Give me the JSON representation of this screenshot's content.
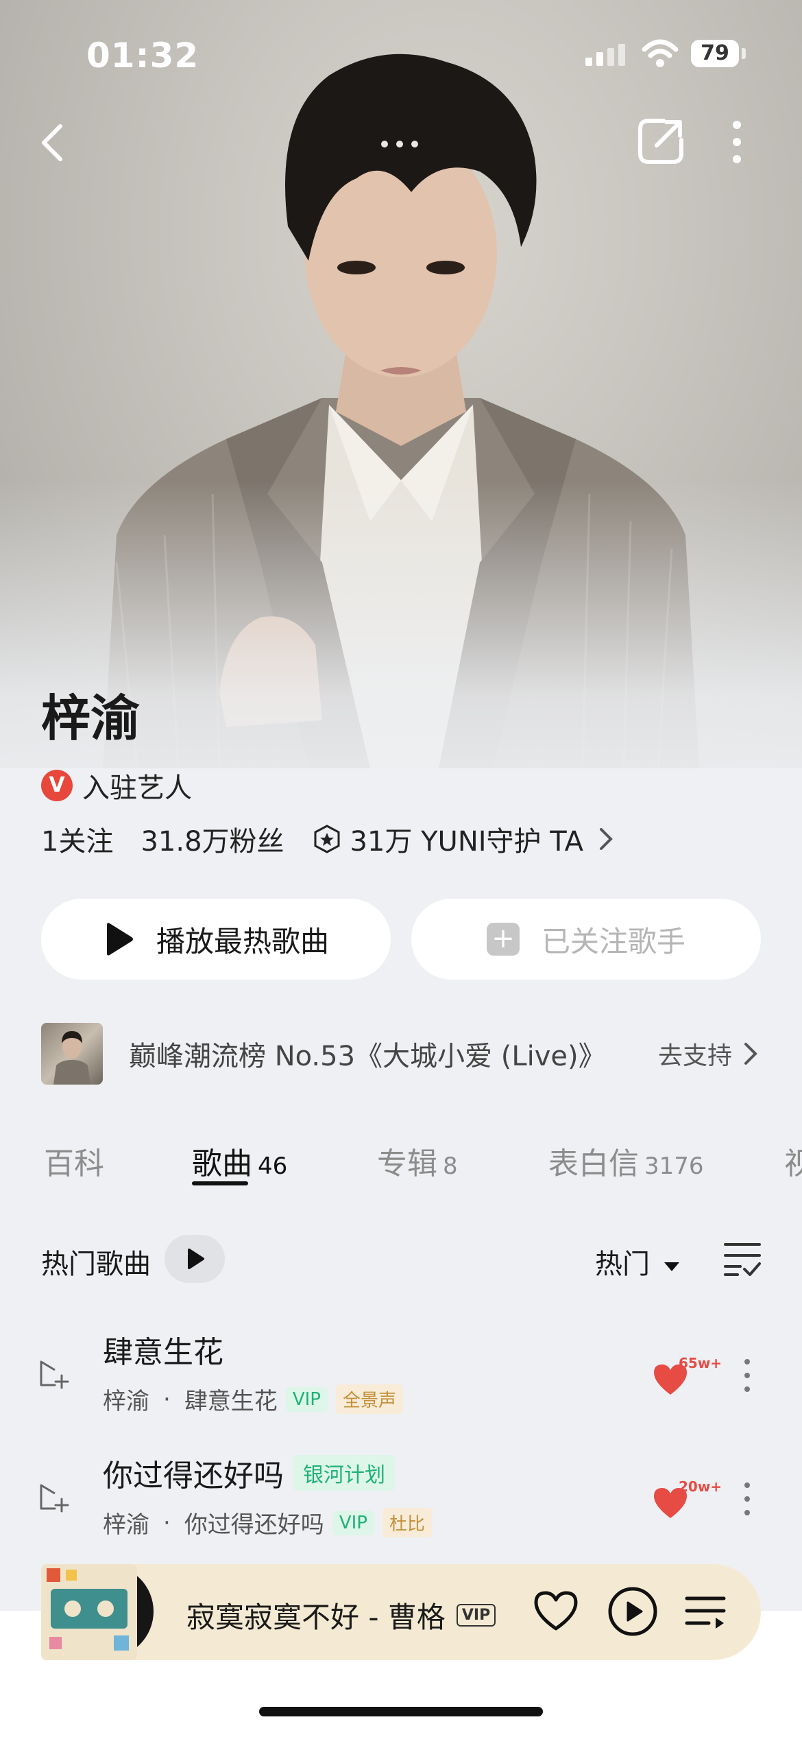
{
  "status": {
    "time": "01:32",
    "battery": "79"
  },
  "artist": {
    "name": "梓渝",
    "verified_label": "入驻艺人",
    "verified_badge": "V",
    "following": "1关注",
    "fans": "31.8万粉丝",
    "guard": "31万 YUNI守护 TA"
  },
  "buttons": {
    "play_hot": "播放最热歌曲",
    "followed": "已关注歌手"
  },
  "rank": {
    "text": "巅峰潮流榜 No.53《大城小爱 (Live)》",
    "action": "去支持"
  },
  "tabs": [
    {
      "label": "百科",
      "count": ""
    },
    {
      "label": "歌曲",
      "count": "46"
    },
    {
      "label": "专辑",
      "count": "8"
    },
    {
      "label": "表白信",
      "count": "3176"
    },
    {
      "label": "视",
      "count": ""
    }
  ],
  "hot": {
    "title": "热门歌曲",
    "sort": "热门"
  },
  "songs": [
    {
      "title": "肆意生花",
      "title_tag": "",
      "artist": "梓渝",
      "album": "肆意生花",
      "tag1": "VIP",
      "tag2": "全景声",
      "likes": "65w+"
    },
    {
      "title": "你过得还好吗",
      "title_tag": "银河计划",
      "artist": "梓渝",
      "album": "你过得还好吗",
      "tag1": "VIP",
      "tag2": "杜比",
      "likes": "20w+"
    }
  ],
  "player": {
    "song": "寂寞寂寞不好 - 曹格",
    "badge": "VIP"
  },
  "colors": {
    "accent_red": "#e8473c",
    "heart_red": "#e64b44",
    "vip_green": "#1eb277",
    "player_bg": "#f4ead3"
  },
  "icons": [
    "back-icon",
    "share-icon",
    "more-icon",
    "play-icon",
    "plus-icon",
    "chevron-right-icon",
    "guard-icon",
    "add-to-playlist-icon",
    "heart-icon",
    "kebab-icon",
    "list-check-icon",
    "dropdown-icon",
    "queue-icon"
  ]
}
